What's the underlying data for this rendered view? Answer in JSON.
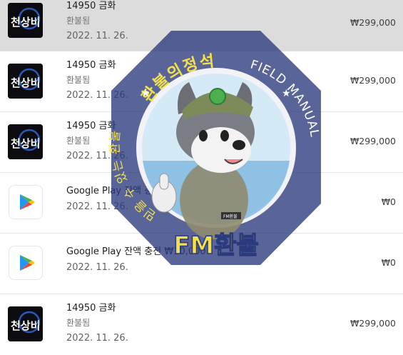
{
  "purchases": [
    {
      "title": "14950 금화",
      "status": "환불됨",
      "date": "2022. 11. 26.",
      "price": "₩299,000",
      "icon": "game-icon",
      "thumb_text": "천상비",
      "highlight": true
    },
    {
      "title": "14950 금화",
      "status": "환불됨",
      "date": "2022. 11. 26.",
      "price": "₩299,000",
      "icon": "game-icon",
      "thumb_text": "천상비"
    },
    {
      "title": "14950 금화",
      "status": "환불됨",
      "date": "2022. 11. 26.",
      "price": "₩299,000",
      "icon": "game-icon",
      "thumb_text": "천상비"
    },
    {
      "title": "Google Play 잔액 충전 ₩50,000",
      "status": "",
      "date": "2022. 11. 26.",
      "price": "₩0",
      "icon": "google-play-icon"
    },
    {
      "title": "Google Play 잔액 충전 ₩10,000",
      "status": "",
      "date": "2022. 11. 26.",
      "price": "₩0",
      "icon": "google-play-icon"
    },
    {
      "title": "14950 금화",
      "status": "환불됨",
      "date": "2022. 11. 26.",
      "price": "₩299,000",
      "icon": "game-icon",
      "thumb_text": "천상비"
    }
  ],
  "watermark": {
    "top_text": "환불의정석",
    "right_text": "FIELD MANUAL",
    "left_text": "믿을 수 있는 환불",
    "brand_text": "FM환불",
    "badge_text": "FM환불"
  },
  "colors": {
    "watermark_navy": "#2a3a7c",
    "watermark_yellow": "#f4e14a",
    "highlight_row": "#dcdcdc"
  }
}
